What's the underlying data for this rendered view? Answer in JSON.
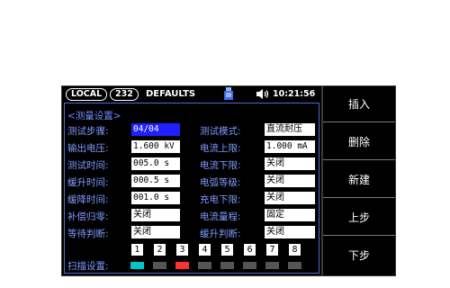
{
  "statusbar": {
    "mode": "LOCAL",
    "interface": "232",
    "config": "DEFAULTS",
    "time": "10:21:56",
    "usb_icon": "usb-drive-icon",
    "volume_icon": "speaker-volume-icon"
  },
  "panel": {
    "title": "<测量设置>",
    "left_fields": [
      {
        "label": "测试步骤:",
        "value": "04/04",
        "selected": true
      },
      {
        "label": "输出电压:",
        "value": "1.600 kV"
      },
      {
        "label": "测试时间:",
        "value": "005.0 s"
      },
      {
        "label": "缓升时间:",
        "value": "000.5 s"
      },
      {
        "label": "缓降时间:",
        "value": "001.0 s"
      },
      {
        "label": "补偿归零:",
        "value": "关闭"
      },
      {
        "label": "等待判断:",
        "value": "关闭"
      }
    ],
    "right_fields": [
      {
        "label": "测试模式:",
        "value": "直流耐压"
      },
      {
        "label": "电流上限:",
        "value": "1.000 mA"
      },
      {
        "label": "电流下限:",
        "value": "关闭"
      },
      {
        "label": "电弧等级:",
        "value": "关闭"
      },
      {
        "label": "充电下限:",
        "value": "关闭"
      },
      {
        "label": "电流量程:",
        "value": "固定"
      },
      {
        "label": "缓升判断:",
        "value": "关闭"
      }
    ],
    "scan": {
      "label": "扫描设置:",
      "channels": [
        "1",
        "2",
        "3",
        "4",
        "5",
        "6",
        "7",
        "8"
      ],
      "channel_colors": [
        "#00c8c8",
        "#555555",
        "#ff3030",
        "#555555",
        "#555555",
        "#555555",
        "#555555",
        "#555555"
      ]
    }
  },
  "menu": {
    "items": [
      "插入",
      "删除",
      "新建",
      "上步",
      "下步"
    ]
  }
}
